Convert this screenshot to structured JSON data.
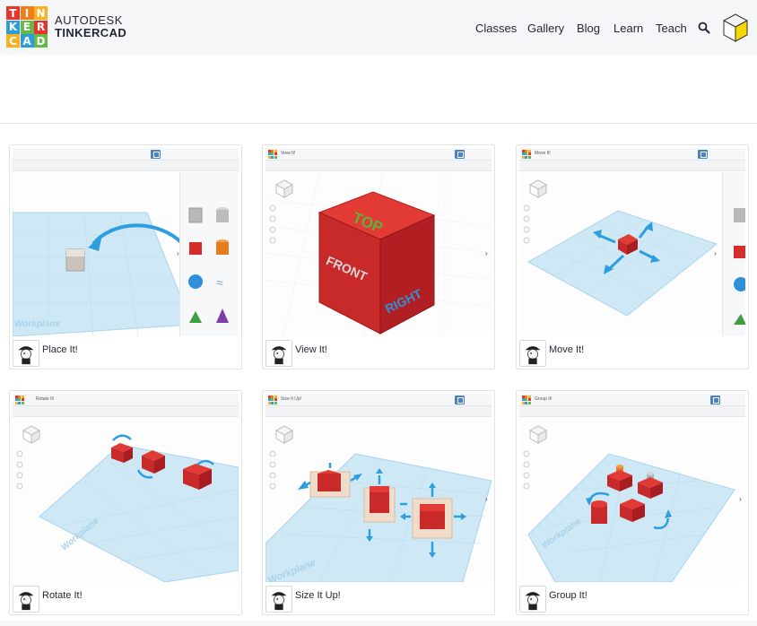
{
  "header": {
    "logo_letters": [
      "T",
      "I",
      "N",
      "K",
      "E",
      "R",
      "C",
      "A",
      "D"
    ],
    "logo_colors": [
      "#e5352e",
      "#f07d1a",
      "#f8b21f",
      "#2e9cd8",
      "#68b94a",
      "#e5352e",
      "#f8b21f",
      "#2e9cd8",
      "#68b94a"
    ],
    "brand_line1": "AUTODESK",
    "brand_line2": "TINKERCAD",
    "nav": [
      {
        "label": "Classes"
      },
      {
        "label": "Gallery"
      },
      {
        "label": "Blog"
      },
      {
        "label": "Learn"
      },
      {
        "label": "Teach"
      }
    ],
    "search_icon": "search-icon",
    "avatar_icon": "cube-avatar-icon"
  },
  "lessons": [
    {
      "title": "Place It!",
      "mini_title": ""
    },
    {
      "title": "View It!",
      "mini_title": "View It!"
    },
    {
      "title": "Move It!",
      "mini_title": "Move It!"
    },
    {
      "title": "Rotate It!",
      "mini_title": "Rotate It!"
    },
    {
      "title": "Size It Up!",
      "mini_title": "Size It Up!"
    },
    {
      "title": "Group It!",
      "mini_title": "Group It!"
    }
  ],
  "thumbnail_labels": {
    "workplane": "Workplane",
    "cube_top": "TOP",
    "cube_front": "FRONT",
    "cube_right": "RIGHT"
  },
  "colors": {
    "accent_blue": "#4a82c4",
    "shape_red": "#d62c2c",
    "arrow_blue": "#2f9ee0",
    "workplane": "#cfe8f5"
  }
}
